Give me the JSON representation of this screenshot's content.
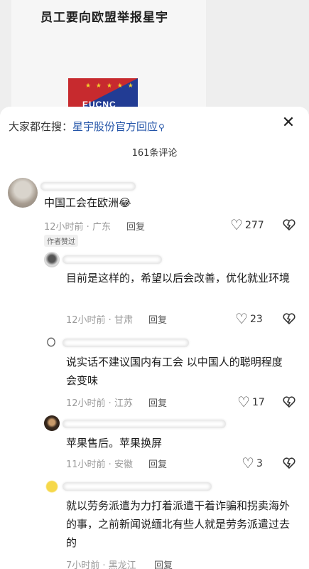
{
  "background": {
    "headline": "员工要向欧盟举报星宇",
    "logo_text": "EUCNC",
    "logo_stars": "★ ★ ★ ★ ★"
  },
  "search": {
    "prefix": "大家都在搜：",
    "term": "星宇股份官方回应",
    "icon": "search-icon"
  },
  "close_icon": "✕",
  "comment_count": "161条评论",
  "comments": [
    {
      "text": "中国工会在欧洲😂",
      "time_location": "12小时前 · 广东",
      "reply_label": "回复",
      "likes": "277",
      "badge": "作者赞过"
    },
    {
      "text": "目前是这样的，希望以后会改善，优化就业环境",
      "time_location": "12小时前 · 甘肃",
      "reply_label": "回复",
      "likes": "23"
    },
    {
      "text": "说实话不建议国内有工会  以中国人的聪明程度 会变味",
      "time_location": "12小时前 · 江苏",
      "reply_label": "回复",
      "likes": "17"
    },
    {
      "text": "苹果售后。苹果换屏",
      "time_location": "11小时前 · 安徽",
      "reply_label": "回复",
      "likes": "3"
    },
    {
      "text": "就以劳务派遣为力打着派遣干着诈骗和拐卖海外的事，之前新闻说缅北有些人就是劳务派遣过去的",
      "time_location": "7小时前 · 黑龙江",
      "reply_label": "回复",
      "likes": ""
    }
  ],
  "colors": {
    "link_blue": "#2354a8",
    "meta_gray": "#9a9a9a"
  }
}
